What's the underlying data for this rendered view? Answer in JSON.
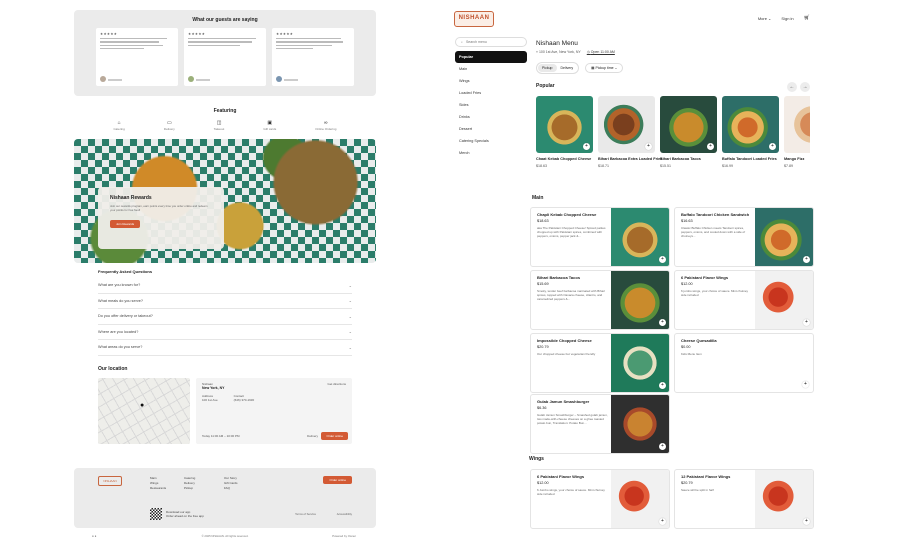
{
  "testimonials": {
    "title": "What our guests are saying",
    "cards": [
      {
        "stars": "★★★★★"
      },
      {
        "stars": "★★★★★"
      },
      {
        "stars": "★★★★★"
      }
    ]
  },
  "featuring": {
    "title": "Featuring",
    "items": [
      {
        "label": "Catering",
        "icon": "cloche-icon"
      },
      {
        "label": "Delivery",
        "icon": "truck-icon"
      },
      {
        "label": "Takeout",
        "icon": "bag-icon"
      },
      {
        "label": "Gift cards",
        "icon": "gift-icon"
      },
      {
        "label": "Online Ordering",
        "icon": "link-icon"
      }
    ]
  },
  "rewards": {
    "title": "Nishaan Rewards",
    "desc": "Join our rewards program, earn points every time you order online and redeem your points for free food!",
    "button": "Join Rewards"
  },
  "faq": {
    "title": "Frequently Asked Questions",
    "items": [
      "What are you known for?",
      "What meals do you serve?",
      "Do you offer delivery or takeout?",
      "Where are you located?",
      "What areas do you serve?"
    ]
  },
  "location": {
    "title": "Our location",
    "name": "Nishaan",
    "city": "New York, NY",
    "directions": "Get directions",
    "address_label": "Address",
    "phone_label": "Contact",
    "address": "100 1st Ave",
    "phone": "(646) 370-1930",
    "hours": "Today 11:00 AM – 10:00 PM",
    "delivery": "Delivery",
    "order": "Order online"
  },
  "footer": {
    "logo": "NISHAAN",
    "col1": [
      "Main",
      "Wings",
      "Restaurants"
    ],
    "col2": [
      "Catering",
      "Delivery",
      "Pickup"
    ],
    "col3": [
      "Our Story",
      "Gift Cards",
      "FAQ"
    ],
    "order": "Order online",
    "qr_text": "Download our app",
    "qr_sub": "Order ahead on the free app",
    "terms": "Terms of Service",
    "access": "Accessibility",
    "copyright": "© 2025 NISHAAN. All rights reserved.",
    "powered": "Powered by Owner"
  },
  "header": {
    "logo": "NISHAAN",
    "nav_more": "More",
    "nav_signin": "Sign in",
    "cart_icon": "cart-icon"
  },
  "sidebar": {
    "search_placeholder": "Search menu",
    "categories": [
      "Popular",
      "Main",
      "Wings",
      "Loaded Fries",
      "Sides",
      "Drinks",
      "Dessert",
      "Catering Specials",
      "Merch"
    ],
    "active": 0
  },
  "menu": {
    "title": "Nishaan Menu",
    "address": "100 1st Ave, New York, NY",
    "open": "Open 11:00 AM",
    "pickup": "Pickup",
    "delivery": "Delivery",
    "pickup_time": "Pickup time"
  },
  "popular": {
    "title": "Popular",
    "items": [
      {
        "name": "Chaat Kebab Chopped Cheese",
        "price": "$18.63"
      },
      {
        "name": "Bihari Barbacoa Extra Loaded Fries",
        "price": "$18.71"
      },
      {
        "name": "Bihari Barbacoa Tacos",
        "price": "$15.51"
      },
      {
        "name": "Buffalo Tandoori Loaded Fries",
        "price": "$16.99"
      },
      {
        "name": "Mango Fizz",
        "price": "$7.89"
      }
    ]
  },
  "main": {
    "title": "Main",
    "items": [
      {
        "name": "Chapli Kebab Chopped Cheese",
        "price": "$18.63",
        "desc": "aka The Pakistani Chopped Cheese! Spiced patties chopped up with Pakistani spices, combined with peppers, onions, pepper jack &..."
      },
      {
        "name": "Buffalo Tandoori Chicken Sandwich",
        "price": "$16.63",
        "desc": "Classic Buffalo Chicken meets Tandoori spices, peppers, onions, and cooled down with a side of chutneys..."
      },
      {
        "name": "Bihari Barbacoa Tacos",
        "price": "$15.69",
        "desc": "Smoky, tender beef barbacoa marinated with Bihari spices, topped with Oaxaca cheese, cilantro, and caramelized peppers &..."
      },
      {
        "name": "6 Pakistani Flavor Wings",
        "price": "$12.00",
        "desc": "6 jumbo wings, your choice of sauce. Mint chutney side included"
      },
      {
        "name": "Impossible Chopped Cheese",
        "price": "$20.79",
        "desc": "Our chopped cheese but vegetarian friendly"
      },
      {
        "name": "Cheese Quesadilla",
        "price": "$0.00",
        "desc": "Kids Menu Item"
      },
      {
        "name": "Gulab Jamun Smashburger",
        "price": "$6.36",
        "desc": "Gulab Jamun Smashburger – Smashed gulab jamun, two made-with-cheese cheeses on a ghee toasted potato bun, Translation: Potato Bun..."
      }
    ]
  },
  "wings": {
    "title": "Wings",
    "items": [
      {
        "name": "6 Pakistani Flavor Wings",
        "price": "$12.00",
        "desc": "6 Jumbo wings, your choice of sauce. Mint chutney side included"
      },
      {
        "name": "12 Pakistani Flavor Wings",
        "price": "$20.79",
        "desc": "Sauce will be split in half"
      }
    ]
  }
}
